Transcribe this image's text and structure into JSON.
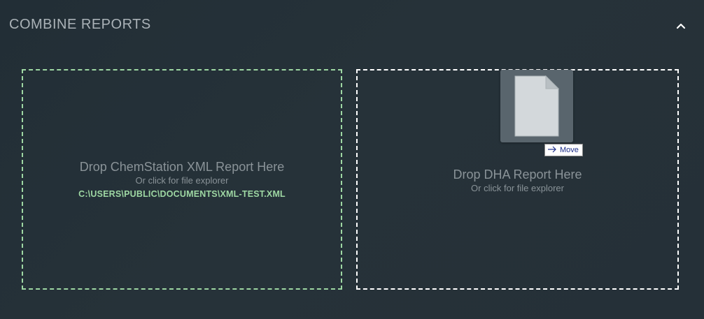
{
  "header": {
    "title": "COMBINE REPORTS",
    "collapse_icon": "chevron-up-icon"
  },
  "dropzones": [
    {
      "title": "Drop ChemStation XML Report Here",
      "subtitle": "Or click for file explorer",
      "file_path": "C:\\USERS\\PUBLIC\\DOCUMENTS\\XML-TEST.XML",
      "border_color": "#9ed7a3"
    },
    {
      "title": "Drop DHA Report Here",
      "subtitle": "Or click for file explorer",
      "border_color": "#ffffff"
    }
  ],
  "drag": {
    "icon": "document-file-icon",
    "tooltip_icon": "arrow-right-icon",
    "tooltip": "Move"
  },
  "colors": {
    "background": "#253038",
    "accent_green": "#9ed7a3",
    "text_muted": "#8a9398"
  }
}
